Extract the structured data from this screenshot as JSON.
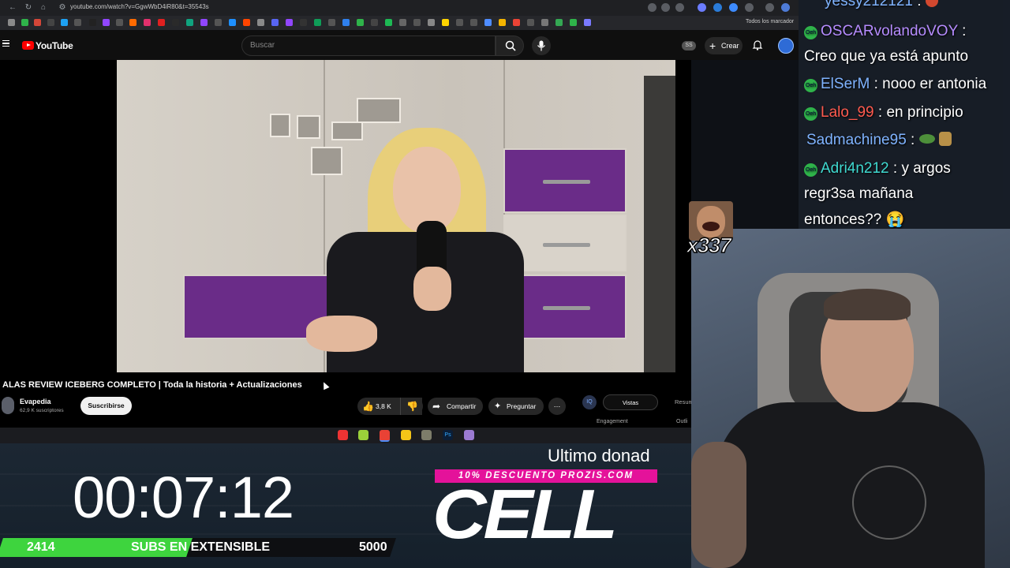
{
  "browser": {
    "url": "youtube.com/watch?v=GgwWbD4iR80&t=35543s",
    "bookmark_folder": "Todos los marcador"
  },
  "youtube": {
    "logo_text": "YouTube",
    "search_placeholder": "Buscar",
    "ss_badge": "SS",
    "create_label": "Crear"
  },
  "video": {
    "title": "ALAS REVIEW ICEBERG COMPLETO | Toda la historia + Actualizaciones",
    "channel_name": "Evapedia",
    "subscribers": "62,9 K suscriptores",
    "subscribe_label": "Suscribirse",
    "likes": "3,8 K",
    "share_label": "Compartir",
    "ask_label": "Preguntar"
  },
  "side_panel": {
    "badge": "IQ",
    "tab_active": "Vistas",
    "tab_other": "Resum",
    "engagement_label": "Engagement",
    "outliers_label": "Outli"
  },
  "chat": {
    "messages": [
      {
        "user": "yessy212121",
        "text": " : ",
        "user_color": "#7fb3ff"
      },
      {
        "user": "OSCARvolandoVOY",
        "text": " :",
        "user_color": "#b68cff",
        "badge": "Oeh"
      },
      {
        "user": "",
        "text": "Creo que ya está apunto",
        "user_color": "#ffffff"
      },
      {
        "user": "ElSerM",
        "text": " : nooo er antonia",
        "user_color": "#7fb3ff",
        "badge": "Oeh"
      },
      {
        "user": "Lalo_99",
        "text": " : en principio",
        "user_color": "#ff5a4e",
        "badge": "Oeh"
      },
      {
        "user": "Sadmachine95",
        "text": " :",
        "user_color": "#7fb3ff"
      },
      {
        "user": "Adri4n212",
        "text": " : y argos",
        "user_color": "#3fd9d0",
        "badge": "Oeh"
      },
      {
        "user": "",
        "text": "regr3sa mañana",
        "user_color": "#ffffff"
      },
      {
        "user": "",
        "text": "entonces?? 😭",
        "user_color": "#ffffff"
      }
    ]
  },
  "emote": {
    "count": "x337"
  },
  "stream_overlay": {
    "timer": "00:07:12",
    "subs_current": "2414",
    "subs_label_a": "SUBS EN ",
    "subs_label_b": "EXTENSIBLE",
    "subs_goal": "5000",
    "subs_progress": 0.4828,
    "last_donation_label": "Ultimo donad",
    "promo_text": "10% DESCUENTO PROZIS.COM",
    "last_donor": "CELL",
    "accent_green": "#3ed43e",
    "accent_pink": "#e4129a"
  }
}
